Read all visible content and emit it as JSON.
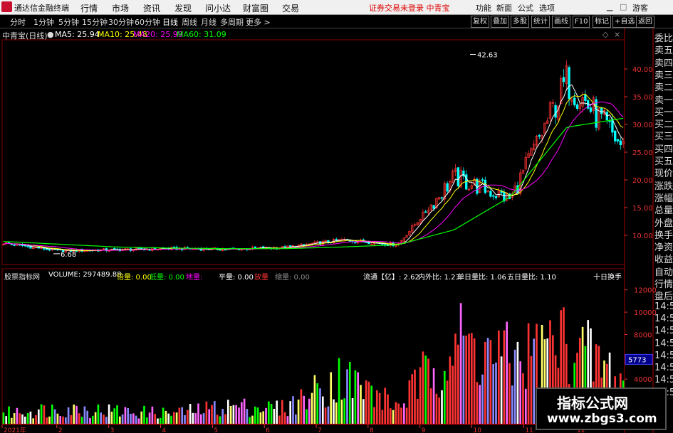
{
  "app": {
    "title": "通达信金融终端"
  },
  "menu": [
    "行情",
    "市场",
    "资讯",
    "发现",
    "问小达",
    "财富圈",
    "交易"
  ],
  "notice": "证券交易未登录  中青宝",
  "menu_right": [
    "功能",
    "新面",
    "公式",
    "选项",
    "游客"
  ],
  "periods": [
    "分时",
    "1分钟",
    "5分钟",
    "15分钟",
    "30分钟",
    "60分钟",
    "日线",
    "周线",
    "月线",
    "多周期",
    "更多 >"
  ],
  "toolbar_right": [
    "复权",
    "叠加",
    "多股",
    "统计",
    "画线",
    "F10",
    "标记",
    "+自选",
    "返回"
  ],
  "main_header": {
    "stock": "中青宝(日线)",
    "ma5": "MA5: 25.94",
    "ma10": "MA10: 25.48",
    "ma20": "MA20: 25.99",
    "ma60": "MA60: 31.09"
  },
  "price_axis": [
    "40.00",
    "35.00",
    "30.00",
    "25.00",
    "20.00",
    "15.00",
    "10.00"
  ],
  "annotations": {
    "high": "42.63",
    "low": "6.68"
  },
  "right_panel": [
    "委比",
    "卖五",
    "卖四",
    "卖三",
    "卖二",
    "卖一",
    "买一",
    "买二",
    "买三",
    "买四",
    "买五",
    "现价",
    "涨跌",
    "涨幅",
    "总量",
    "外盘",
    "换手",
    "净资",
    "收益",
    "自动",
    "行情",
    "盘后",
    "14:5",
    "14:5",
    "14:5",
    "14:5",
    "14:5",
    "14:5",
    "14:5",
    "14:5"
  ],
  "vol_header": {
    "title": "股票指标网",
    "volume": "VOLUME: 297489.88",
    "bei": "倍量: 0.00",
    "di": "低量: 0.00",
    "di2": "地量:",
    "ping": "平量: 0.00",
    "fang": "放量",
    "suo": "缩量: 0.00",
    "liutong": "流通【亿】: 2.62",
    "neiwai": "内外比: 1.23",
    "danri": "单日量比: 1.06",
    "wuri": "五日量比: 1.10",
    "shiri": "十日换手"
  },
  "vol_axis": [
    "12000",
    "10000",
    "8000",
    "6000",
    "4000"
  ],
  "vol_current": "5773",
  "time_axis": [
    "2021年",
    "2",
    "3",
    "4",
    "5",
    "6",
    "7",
    "8",
    "9",
    "10",
    "11",
    "12"
  ],
  "colors": {
    "up": "#ff3333",
    "down": "#00ffff",
    "ma5": "#ffffff",
    "ma10": "#ffff00",
    "ma20": "#ff00ff",
    "ma60": "#00ff00",
    "volume": "#ff3333"
  },
  "watermark": {
    "line1": "指标公式网",
    "line2": "www.zbgs3.com"
  },
  "chart_data": {
    "type": "candlestick",
    "x": [
      "2021-01",
      "2021-02",
      "2021-03",
      "2021-04",
      "2021-05",
      "2021-06",
      "2021-07",
      "2021-08",
      "2021-09",
      "2021-10",
      "2021-11",
      "2021-12"
    ],
    "close": [
      8.6,
      7.2,
      7.4,
      7.6,
      7.5,
      7.8,
      9.2,
      8.3,
      20.5,
      16.5,
      38.0,
      25.8
    ],
    "ma60": [
      8.9,
      8.4,
      7.9,
      7.7,
      7.6,
      7.6,
      7.9,
      8.3,
      11.0,
      17.0,
      29.5,
      31.1
    ],
    "volume_peak": [
      1500,
      2200,
      1800,
      1500,
      2500,
      2200,
      6800,
      2400,
      11800,
      9000,
      11800,
      6000
    ],
    "ylim": [
      5,
      45
    ],
    "vol_ylim": [
      0,
      13000
    ]
  }
}
